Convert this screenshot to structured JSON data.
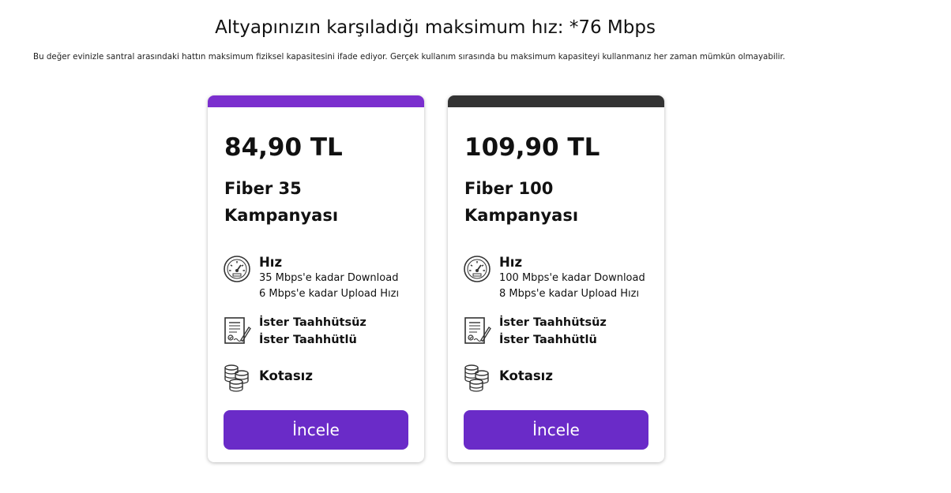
{
  "header": {
    "title": "Altyapınızın karşıladığı maksimum hız: *76 Mbps",
    "note": "Bu değer evinizle santral arasındaki hattın maksimum fiziksel kapasitesini ifade ediyor. Gerçek kullanım sırasında bu maksimum kapasiteyi kullanmanız her zaman mümkün olmayabilir."
  },
  "plans": [
    {
      "accent_color": "#7b2fce",
      "price": "84,90 TL",
      "name": "Fiber 35 Kampanyası",
      "speed_title": "Hız",
      "download": "35 Mbps'e kadar Download",
      "upload": "6 Mbps'e kadar Upload Hızı",
      "contract_option_1": "İster Taahhütsüz",
      "contract_option_2": "İster Taahhütlü",
      "quota": "Kotasız",
      "cta_label": "İncele"
    },
    {
      "accent_color": "#333333",
      "price": "109,90 TL",
      "name": "Fiber 100 Kampanyası",
      "speed_title": "Hız",
      "download": "100 Mbps'e kadar Download",
      "upload": "8 Mbps'e kadar Upload Hızı",
      "contract_option_1": "İster Taahhütsüz",
      "contract_option_2": "İster Taahhütlü",
      "quota": "Kotasız",
      "cta_label": "İncele"
    }
  ],
  "colors": {
    "button": "#6a2bc8",
    "text": "#111111"
  },
  "icons": {
    "speed": "speedometer-icon",
    "contract": "contract-icon",
    "quota": "coin-stack-icon"
  }
}
